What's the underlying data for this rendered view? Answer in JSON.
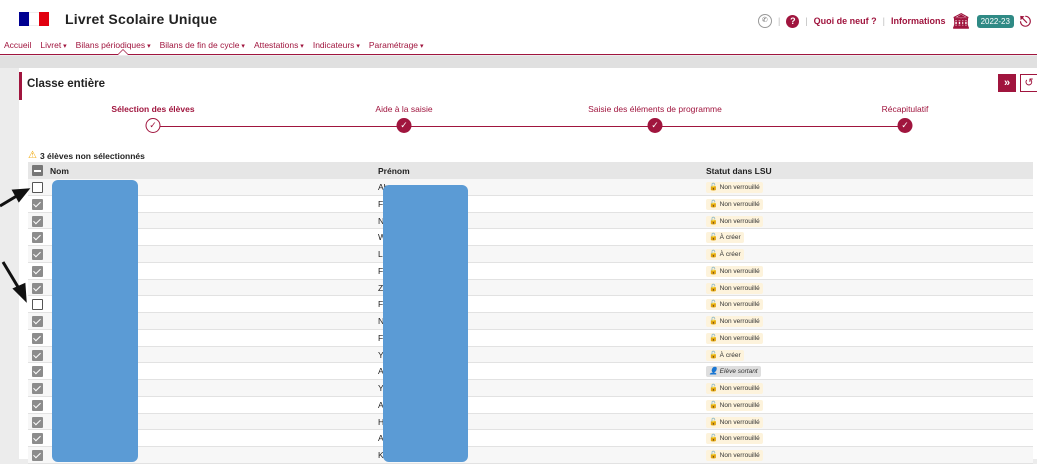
{
  "header": {
    "title": "Livret Scolaire Unique",
    "links": {
      "news": "Quoi de neuf ?",
      "info": "Informations"
    },
    "year": "2022-23",
    "flag_colors": [
      "#000091",
      "#ffffff",
      "#e1000f"
    ]
  },
  "nav": {
    "items": [
      {
        "label": "Accueil",
        "dropdown": false
      },
      {
        "label": "Livret",
        "dropdown": true
      },
      {
        "label": "Bilans périodiques",
        "dropdown": true
      },
      {
        "label": "Bilans de fin de cycle",
        "dropdown": true
      },
      {
        "label": "Attestations",
        "dropdown": true
      },
      {
        "label": "Indicateurs",
        "dropdown": true
      },
      {
        "label": "Paramétrage",
        "dropdown": true
      }
    ],
    "active_index": 2
  },
  "panel": {
    "title": "Classe entière",
    "next_icon": "»",
    "reset_icon": "↺"
  },
  "stepper": {
    "steps": [
      {
        "label": "Sélection des élèves",
        "active": true
      },
      {
        "label": "Aide à la saisie",
        "active": false
      },
      {
        "label": "Saisie des éléments de programme",
        "active": false
      },
      {
        "label": "Récapitulatif",
        "active": false
      }
    ]
  },
  "notice": "3 élèves non sélectionnés",
  "table": {
    "headers": {
      "nom": "Nom",
      "prenom": "Prénom",
      "statut": "Statut dans LSU"
    },
    "rows": [
      {
        "checked": false,
        "nom": "",
        "prenom": "Ab",
        "statut": "Non verrouillé",
        "kind": "unlocked"
      },
      {
        "checked": true,
        "nom": "",
        "prenom": "F",
        "statut": "Non verrouillé",
        "kind": "unlocked"
      },
      {
        "checked": true,
        "nom": "",
        "prenom": "N",
        "statut": "Non verrouillé",
        "kind": "unlocked"
      },
      {
        "checked": true,
        "nom": "",
        "prenom": "W",
        "statut": "À créer",
        "kind": "create"
      },
      {
        "checked": true,
        "nom": "",
        "prenom": "L",
        "statut": "À créer",
        "kind": "create"
      },
      {
        "checked": true,
        "nom": "",
        "prenom": "F",
        "statut": "Non verrouillé",
        "kind": "unlocked"
      },
      {
        "checked": true,
        "nom": "",
        "prenom": "Z",
        "statut": "Non verrouillé",
        "kind": "unlocked"
      },
      {
        "checked": false,
        "nom": "",
        "prenom": "F",
        "statut": "Non verrouillé",
        "kind": "unlocked"
      },
      {
        "checked": true,
        "nom": "",
        "prenom": "N",
        "statut": "Non verrouillé",
        "kind": "unlocked"
      },
      {
        "checked": true,
        "nom": "",
        "prenom": "F",
        "statut": "Non verrouillé",
        "kind": "unlocked"
      },
      {
        "checked": true,
        "nom": "",
        "prenom": "Y",
        "statut": "À créer",
        "kind": "create"
      },
      {
        "checked": true,
        "nom": "",
        "prenom": "A",
        "statut": "Elève sortant",
        "kind": "leaving"
      },
      {
        "checked": true,
        "nom": "",
        "prenom": "Y",
        "statut": "Non verrouillé",
        "kind": "unlocked"
      },
      {
        "checked": true,
        "nom": "",
        "prenom": "A",
        "statut": "Non verrouillé",
        "kind": "unlocked"
      },
      {
        "checked": true,
        "nom": "",
        "prenom": "H",
        "statut": "Non verrouillé",
        "kind": "unlocked"
      },
      {
        "checked": true,
        "nom": "",
        "prenom": "A",
        "statut": "Non verrouillé",
        "kind": "unlocked"
      },
      {
        "checked": true,
        "nom": "",
        "prenom": "K",
        "statut": "Non verrouillé",
        "kind": "unlocked"
      }
    ]
  },
  "colors": {
    "accent": "#a0153e",
    "year_badge": "#2f8a85",
    "redaction": "#5b9bd5"
  }
}
